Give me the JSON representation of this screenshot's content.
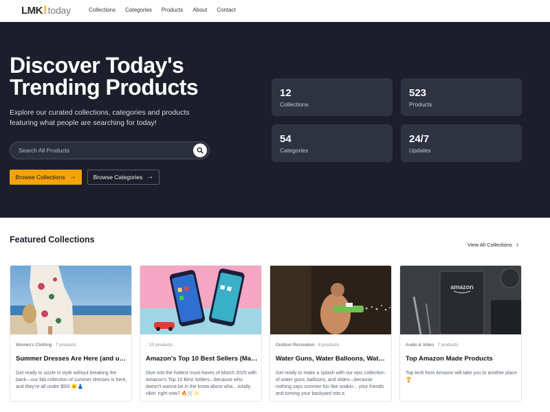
{
  "brand": {
    "logo_main": "LMK",
    "logo_mark": "!",
    "logo_sub": "today"
  },
  "nav": {
    "items": [
      "Collections",
      "Categories",
      "Products",
      "About",
      "Contact"
    ]
  },
  "hero": {
    "title": "Discover Today's Trending Products",
    "subtitle": "Explore our curated collections, categories and products featuring what people are searching for today!",
    "search_placeholder": "Search All Products",
    "primary_button": "Browse Collections",
    "secondary_button": "Browse Categories",
    "stats": [
      {
        "value": "12",
        "label": "Collections"
      },
      {
        "value": "523",
        "label": "Products"
      },
      {
        "value": "54",
        "label": "Categories"
      },
      {
        "value": "24/7",
        "label": "Updates"
      }
    ]
  },
  "featured": {
    "title": "Featured Collections",
    "view_all": "View All Collections",
    "cards": [
      {
        "category": "Women's Clothing",
        "count": "7 products",
        "title": "Summer Dresses Are Here (and und...",
        "description": "Get ready to sizzle in style without breaking the bank—our fab collection of summer dresses is here, and they're all under $50! 🌞👗"
      },
      {
        "category": "",
        "count": "10 products",
        "title": "Amazon's Top 10 Best Sellers (Marc...",
        "description": "Dive into the hottest must-haves of March 2025 with Amazon's Top 10 Best Sellers—because who doesn't wanna be in the know about wha... totally vibin' right now? 🔥🛒✨"
      },
      {
        "category": "Outdoor Recreation",
        "count": "8 products",
        "title": "Water Guns, Water Balloons, Water...",
        "description": "Get ready to make a splash with our epic collection of water guns, balloons, and slides—because nothing says summer fun like soakin... your friends and turning your backyard into a"
      },
      {
        "category": "Audio & Video",
        "count": "7 products",
        "title": "Top Amazon Made Products",
        "description": "Top tech from Amazon will take you to another place 🏆"
      }
    ]
  },
  "colors": {
    "accent": "#f5a30a",
    "hero_bg": "#1c1f2b",
    "stat_bg": "#2e3241"
  }
}
